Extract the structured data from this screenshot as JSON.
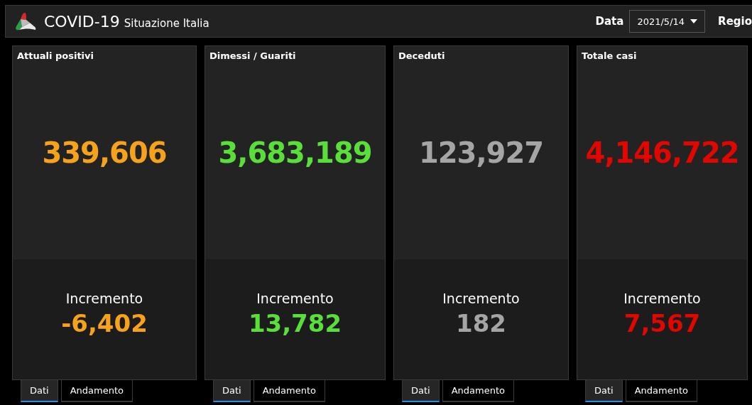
{
  "header": {
    "title": "COVID-19",
    "subtitle": "Situazione Italia",
    "date_label": "Data",
    "date_value": "2021/5/14",
    "region_label": "Regio"
  },
  "cards": [
    {
      "title": "Attuali positivi",
      "value": "339,606",
      "increment_label": "Incremento",
      "increment": "-6,402",
      "color": "#f7a21b",
      "tabs": [
        {
          "label": "Dati",
          "selected": true
        },
        {
          "label": "Andamento",
          "selected": false
        }
      ]
    },
    {
      "title": "Dimessi / Guariti",
      "value": "3,683,189",
      "increment_label": "Incremento",
      "increment": "13,782",
      "color": "#5ade3a",
      "tabs": [
        {
          "label": "Dati",
          "selected": true
        },
        {
          "label": "Andamento",
          "selected": false
        }
      ]
    },
    {
      "title": "Deceduti",
      "value": "123,927",
      "increment_label": "Incremento",
      "increment": "182",
      "color": "#a5a5a5",
      "tabs": [
        {
          "label": "Dati",
          "selected": true
        },
        {
          "label": "Andamento",
          "selected": false
        }
      ]
    },
    {
      "title": "Totale casi",
      "value": "4,146,722",
      "increment_label": "Incremento",
      "increment": "7,567",
      "color": "#e10600",
      "tabs": [
        {
          "label": "Dati",
          "selected": true
        },
        {
          "label": "Andamento",
          "selected": false
        }
      ]
    }
  ]
}
